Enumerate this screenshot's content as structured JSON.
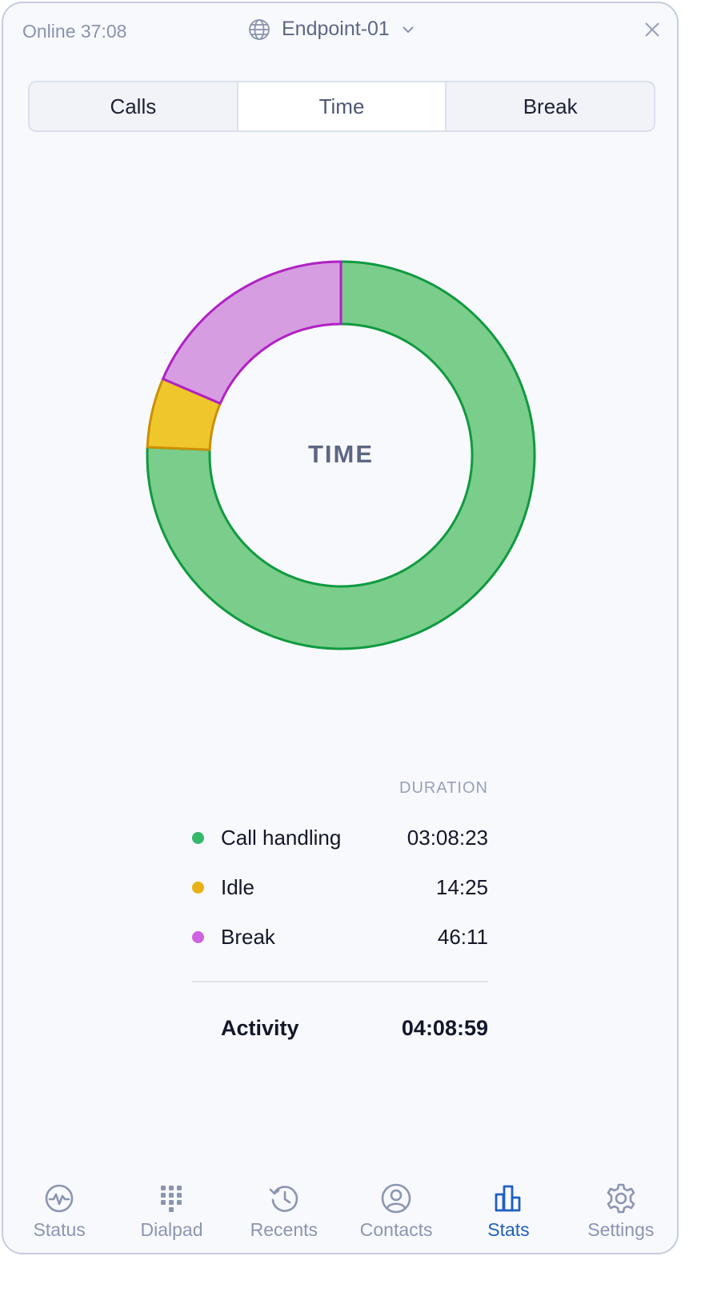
{
  "header": {
    "status_text": "Online 37:08",
    "endpoint_name": "Endpoint-01"
  },
  "tabs": [
    {
      "label": "Calls",
      "active": false
    },
    {
      "label": "Time",
      "active": true
    },
    {
      "label": "Break",
      "active": false
    }
  ],
  "chart_data": {
    "type": "pie",
    "center_label": "TIME",
    "categories": [
      "Call handling",
      "Idle",
      "Break"
    ],
    "values": [
      11303,
      865,
      2771
    ],
    "colors": {
      "fill": [
        "#7acd8a",
        "#efc72c",
        "#d69de0"
      ],
      "stroke": [
        "#0f9a3f",
        "#cc8f05",
        "#b021c4"
      ]
    }
  },
  "legend": {
    "column_header": "DURATION",
    "rows": [
      {
        "label": "Call handling",
        "value": "03:08:23",
        "color": "#34b86a"
      },
      {
        "label": "Idle",
        "value": "14:25",
        "color": "#e9b214"
      },
      {
        "label": "Break",
        "value": "46:11",
        "color": "#cf62e0"
      }
    ],
    "total_label": "Activity",
    "total_value": "04:08:59"
  },
  "nav": {
    "items": [
      {
        "label": "Status",
        "icon": "pulse-icon",
        "active": false
      },
      {
        "label": "Dialpad",
        "icon": "dialpad-icon",
        "active": false
      },
      {
        "label": "Recents",
        "icon": "history-icon",
        "active": false
      },
      {
        "label": "Contacts",
        "icon": "user-circle-icon",
        "active": false
      },
      {
        "label": "Stats",
        "icon": "bar-chart-icon",
        "active": true
      },
      {
        "label": "Settings",
        "icon": "gear-icon",
        "active": false
      }
    ]
  }
}
